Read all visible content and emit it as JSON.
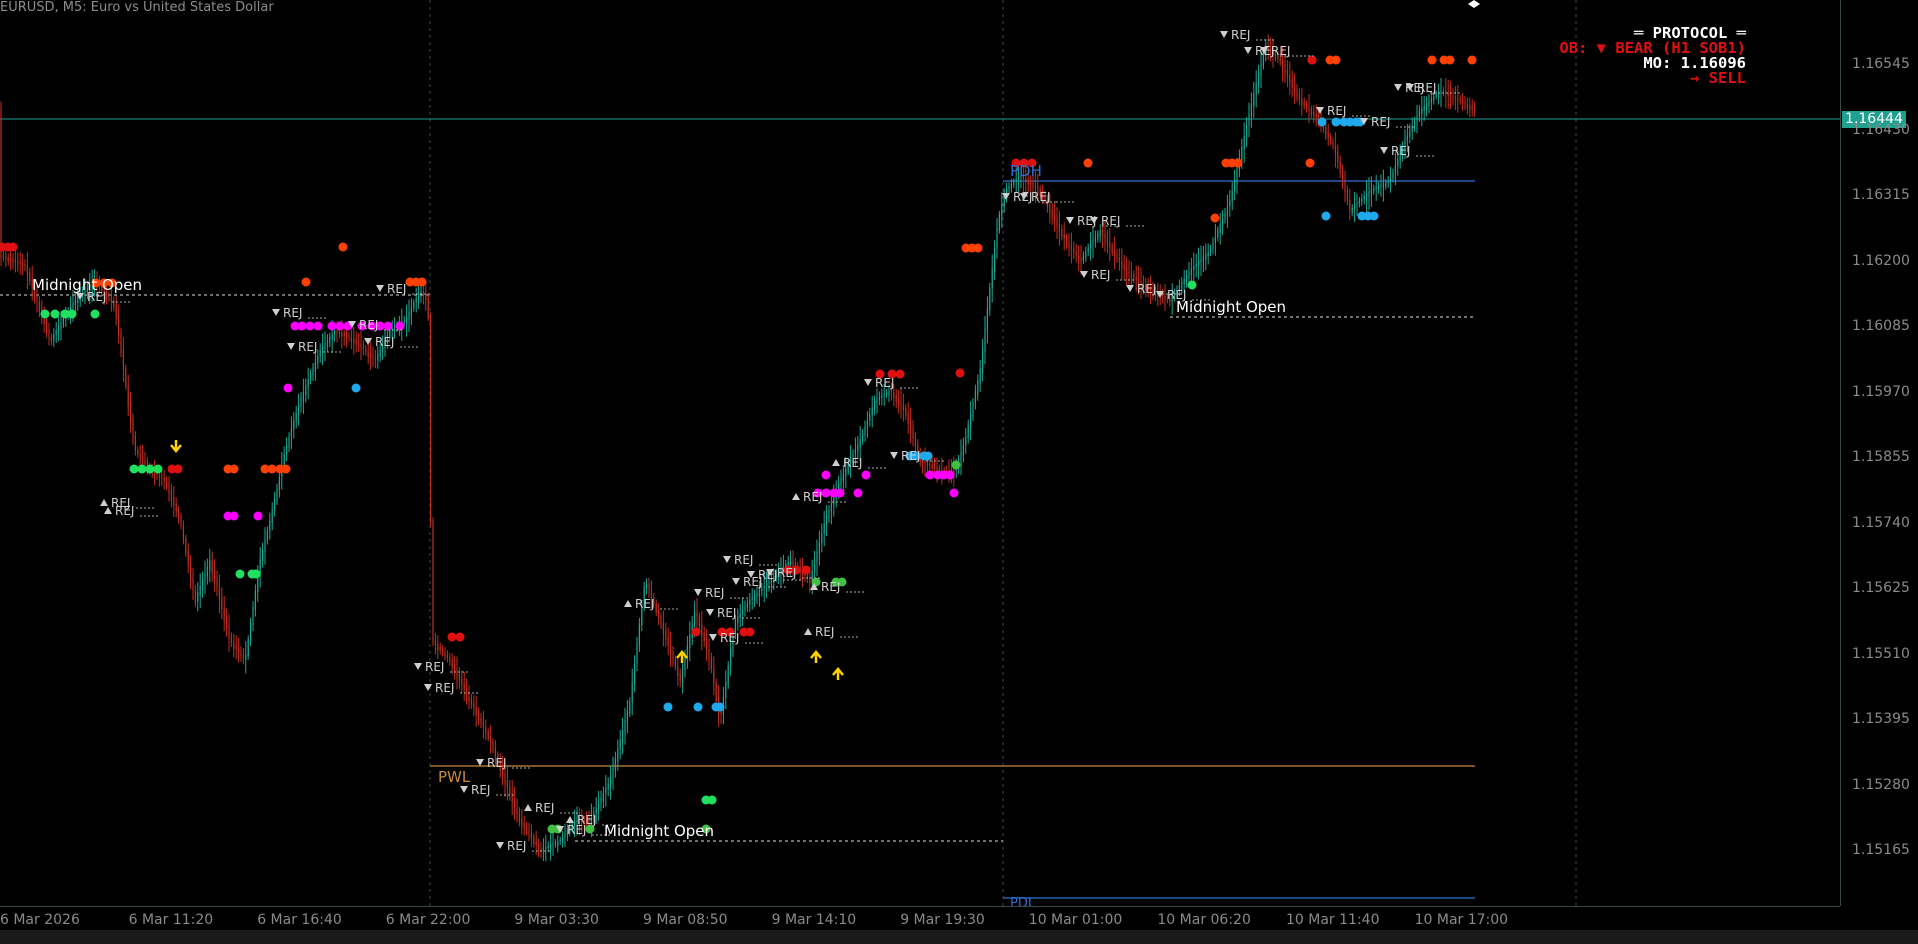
{
  "chart": {
    "title": "EURUSD, M5:  Euro vs United States Dollar",
    "current_price": "1.16444",
    "colors": {
      "background": "#000000",
      "bull_candle": "#1fa894",
      "bear_candle": "#c03020",
      "grid": "#3a4a4a",
      "pdh_line": "#2f6fd0",
      "pwl_line": "#c88a3a",
      "price_line": "#20a090",
      "midnight_line": "#ffffff"
    }
  },
  "protocol": {
    "title": "═ PROTOCOL ═",
    "ob": "OB: ▼ BEAR (H1 SOB1)",
    "mo": "MO: 1.16096",
    "signal": "→ SELL"
  },
  "price_axis": [
    "1.16545",
    "1.16430",
    "1.16315",
    "1.16200",
    "1.16085",
    "1.15970",
    "1.15855",
    "1.15740",
    "1.15625",
    "1.15510",
    "1.15395",
    "1.15280",
    "1.15165"
  ],
  "time_axis": [
    "6 Mar 2026",
    "6 Mar 11:20",
    "6 Mar 16:40",
    "6 Mar 22:00",
    "9 Mar 03:30",
    "9 Mar 08:50",
    "9 Mar 14:10",
    "9 Mar 19:30",
    "10 Mar 01:00",
    "10 Mar 06:20",
    "10 Mar 11:40",
    "10 Mar 17:00"
  ],
  "levels": {
    "pdh": "PDH",
    "pwl": "PWL",
    "pdl": "PDL"
  },
  "midnight": [
    "Midnight Open",
    "Midnight Open",
    "Midnight Open"
  ],
  "rej_label": "REJ",
  "signal_arrows": {
    "down_icon": "arrow-down-icon",
    "up_icon": "arrow-up-icon"
  }
}
